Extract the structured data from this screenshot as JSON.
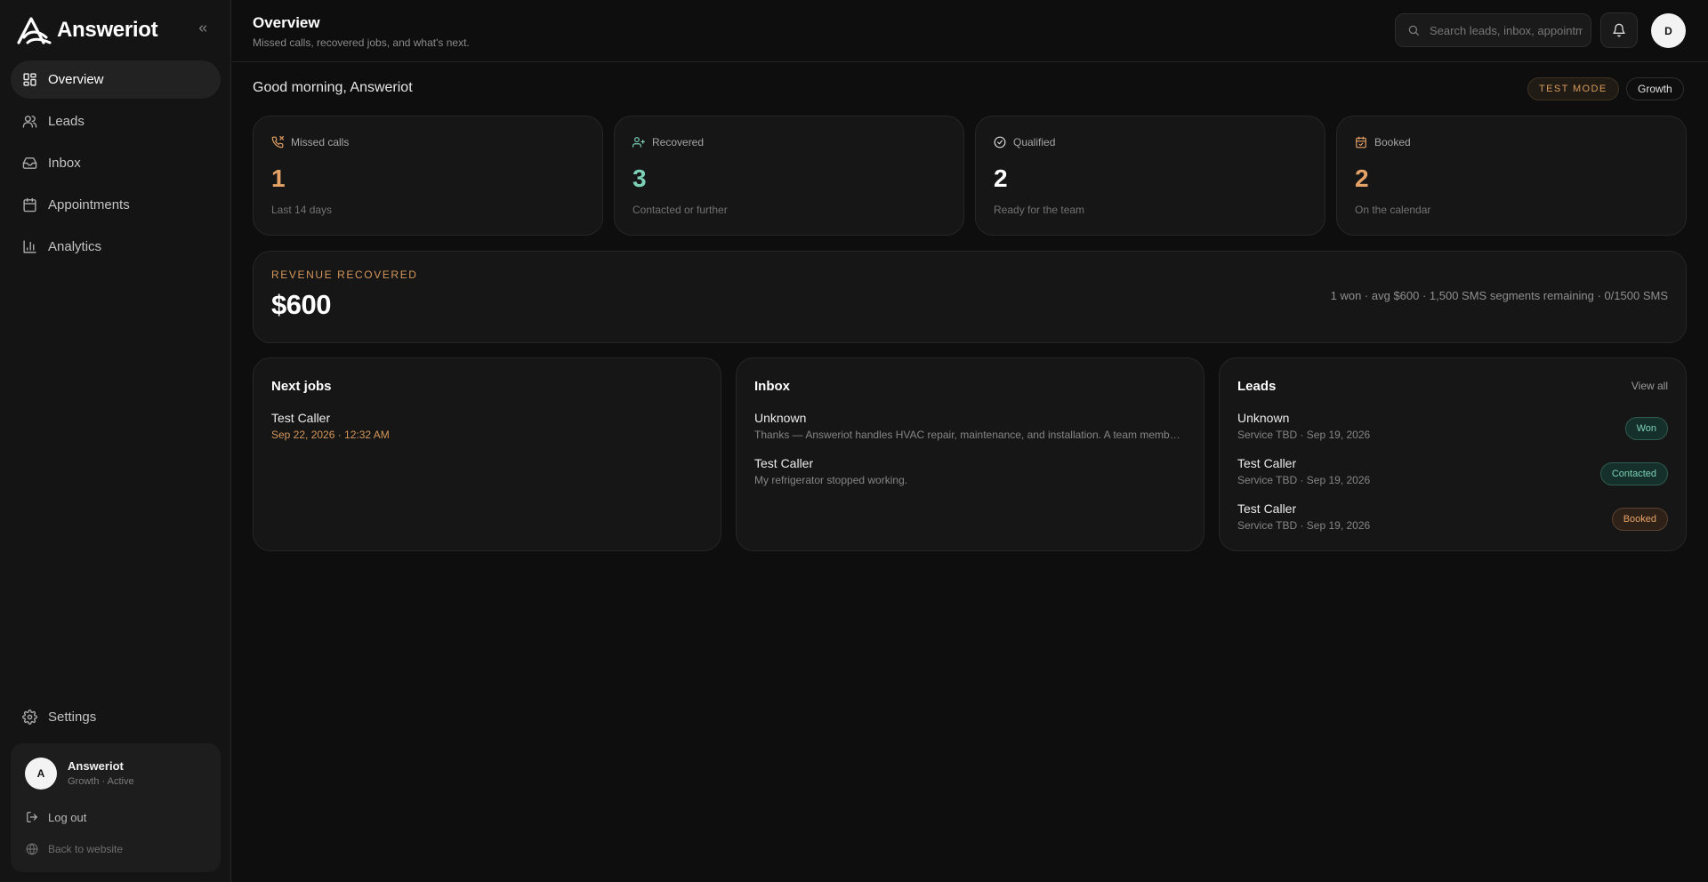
{
  "brand": {
    "name": "Answeriot"
  },
  "sidebar": {
    "items": [
      {
        "label": "Overview"
      },
      {
        "label": "Leads"
      },
      {
        "label": "Inbox"
      },
      {
        "label": "Appointments"
      },
      {
        "label": "Analytics"
      }
    ],
    "settings": {
      "label": "Settings"
    },
    "user": {
      "initial": "A",
      "name": "Answeriot",
      "plan": "Growth · Active",
      "logout": "Log out",
      "back": "Back to website"
    }
  },
  "header": {
    "title": "Overview",
    "subtitle": "Missed calls, recovered jobs, and what's next.",
    "search_placeholder": "Search leads, inbox, appointments",
    "avatar_initial": "D"
  },
  "greeting": "Good morning, Answeriot",
  "badges": {
    "mode": "TEST MODE",
    "plan": "Growth"
  },
  "stats": [
    {
      "label": "Missed calls",
      "value": "1",
      "note": "Last 14 days",
      "color": "#e5a267",
      "icon": "phone-missed-icon"
    },
    {
      "label": "Recovered",
      "value": "3",
      "note": "Contacted or further",
      "color": "#7bd0b6",
      "icon": "user-plus-icon"
    },
    {
      "label": "Qualified",
      "value": "2",
      "note": "Ready for the team",
      "color": "#ffffff",
      "icon": "check-circle-icon"
    },
    {
      "label": "Booked",
      "value": "2",
      "note": "On the calendar",
      "color": "#e5a267",
      "icon": "calendar-check-icon"
    }
  ],
  "revenue": {
    "label": "REVENUE RECOVERED",
    "value": "$600",
    "meta": "1 won · avg $600 · 1,500 SMS segments remaining · 0/1500 SMS"
  },
  "next_jobs": {
    "title": "Next jobs",
    "items": [
      {
        "name": "Test Caller",
        "when": "Sep 22, 2026 · 12:32 AM"
      }
    ]
  },
  "inbox": {
    "title": "Inbox",
    "items": [
      {
        "name": "Unknown",
        "preview": "Thanks — Answeriot handles HVAC repair, maintenance, and installation. A team member will follow up shortly."
      },
      {
        "name": "Test Caller",
        "preview": "My refrigerator stopped working."
      }
    ]
  },
  "leads": {
    "title": "Leads",
    "view_all": "View all",
    "items": [
      {
        "name": "Unknown",
        "meta": "Service TBD · Sep 19, 2026",
        "status": "Won",
        "status_color": "#7bd0b6"
      },
      {
        "name": "Test Caller",
        "meta": "Service TBD · Sep 19, 2026",
        "status": "Contacted",
        "status_color": "#7bd0b6"
      },
      {
        "name": "Test Caller",
        "meta": "Service TBD · Sep 19, 2026",
        "status": "Booked",
        "status_color": "#e5a267"
      }
    ]
  },
  "colors": {
    "accent_orange": "#e5a267",
    "accent_teal": "#7bd0b6",
    "background": "#0e0e0e",
    "card": "#161616"
  }
}
